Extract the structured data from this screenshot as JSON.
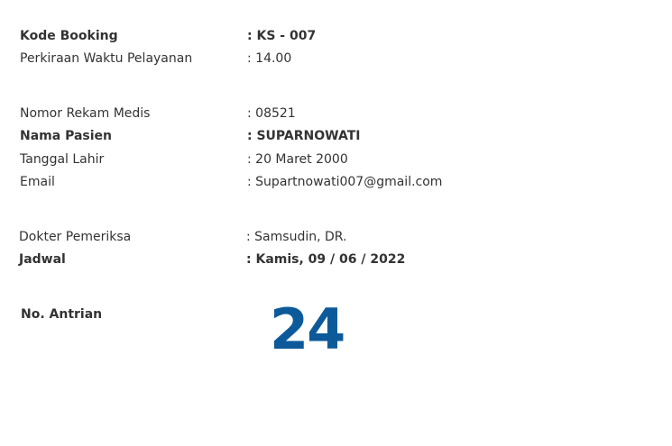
{
  "booking": {
    "code_label": "Kode Booking",
    "code_value": ": KS - 007",
    "service_time_label": "Perkiraan Waktu Pelayanan",
    "service_time_value": ": 14.00"
  },
  "patient": {
    "record_label": "Nomor Rekam Medis",
    "record_value": ": 08521",
    "name_label": "Nama Pasien",
    "name_value": ": SUPARNOWATI",
    "dob_label": "Tanggal Lahir",
    "dob_value": ": 20 Maret 2000",
    "email_label": "Email",
    "email_value": ": Supartnowati007@gmail.com"
  },
  "appointment": {
    "doctor_label": "Dokter Pemeriksa",
    "doctor_value": ": Samsudin, DR.",
    "schedule_label": "Jadwal",
    "schedule_value": ": Kamis, 09 / 06 / 2022"
  },
  "queue": {
    "label": "No. Antrian",
    "number": "24",
    "number_color": "#0d5a9a"
  },
  "colors": {
    "text": "#333333",
    "background": "#ffffff"
  }
}
